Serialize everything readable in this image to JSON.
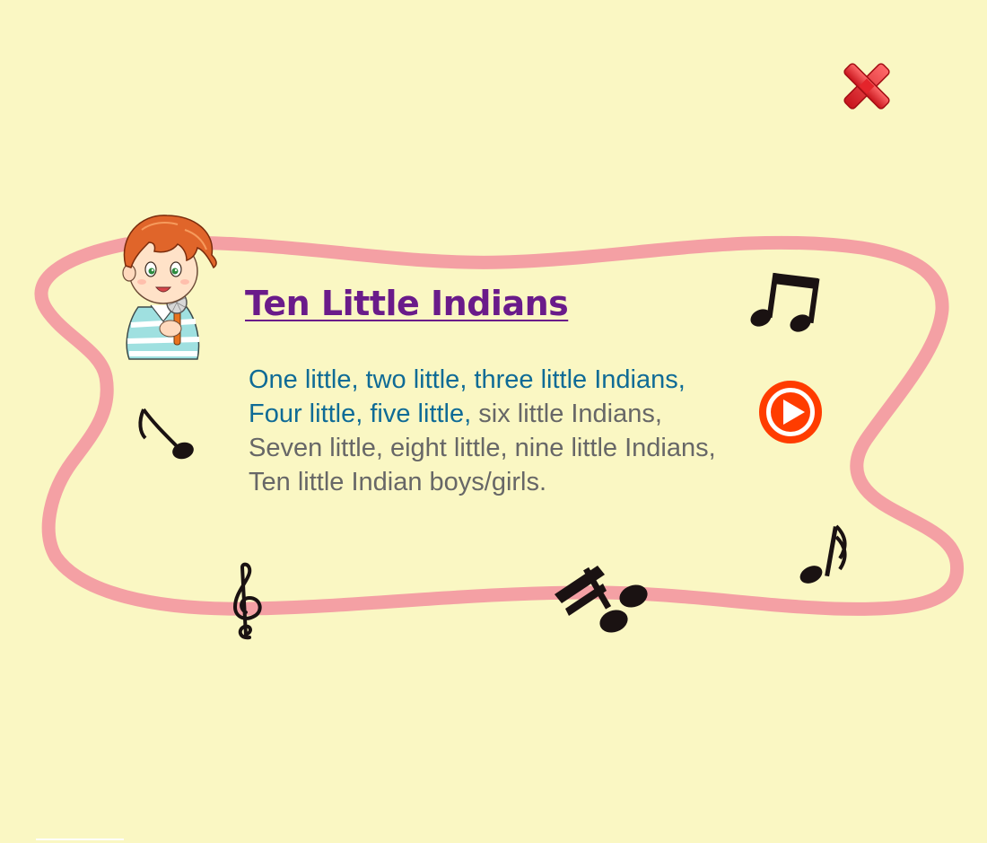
{
  "song": {
    "title": "Ten Little Indians",
    "lines": [
      {
        "sung": "One little, two little, three little Indians,",
        "rest": ""
      },
      {
        "sung": "Four little, five little,",
        "rest": " six little Indians,"
      },
      {
        "sung": "",
        "rest": "Seven little, eight little, nine little Indians,"
      },
      {
        "sung": "",
        "rest": "Ten little Indian boys/girls."
      }
    ]
  },
  "icons": {
    "close": "close-x-icon",
    "play": "play-circle-icon",
    "singer": "boy-with-microphone-illustration",
    "notes": [
      "beamed-eighth-notes-icon",
      "eighth-note-icon",
      "sixteenth-note-icon",
      "treble-clef-icon",
      "beamed-sixteenth-notes-icon"
    ]
  },
  "colors": {
    "background": "#faf7c3",
    "frame": "#f4a0a4",
    "title": "#6a1b8a",
    "sung_text": "#0f6b96",
    "unsung_text": "#676767",
    "play": "#ff3c00",
    "close": "#e12128"
  }
}
